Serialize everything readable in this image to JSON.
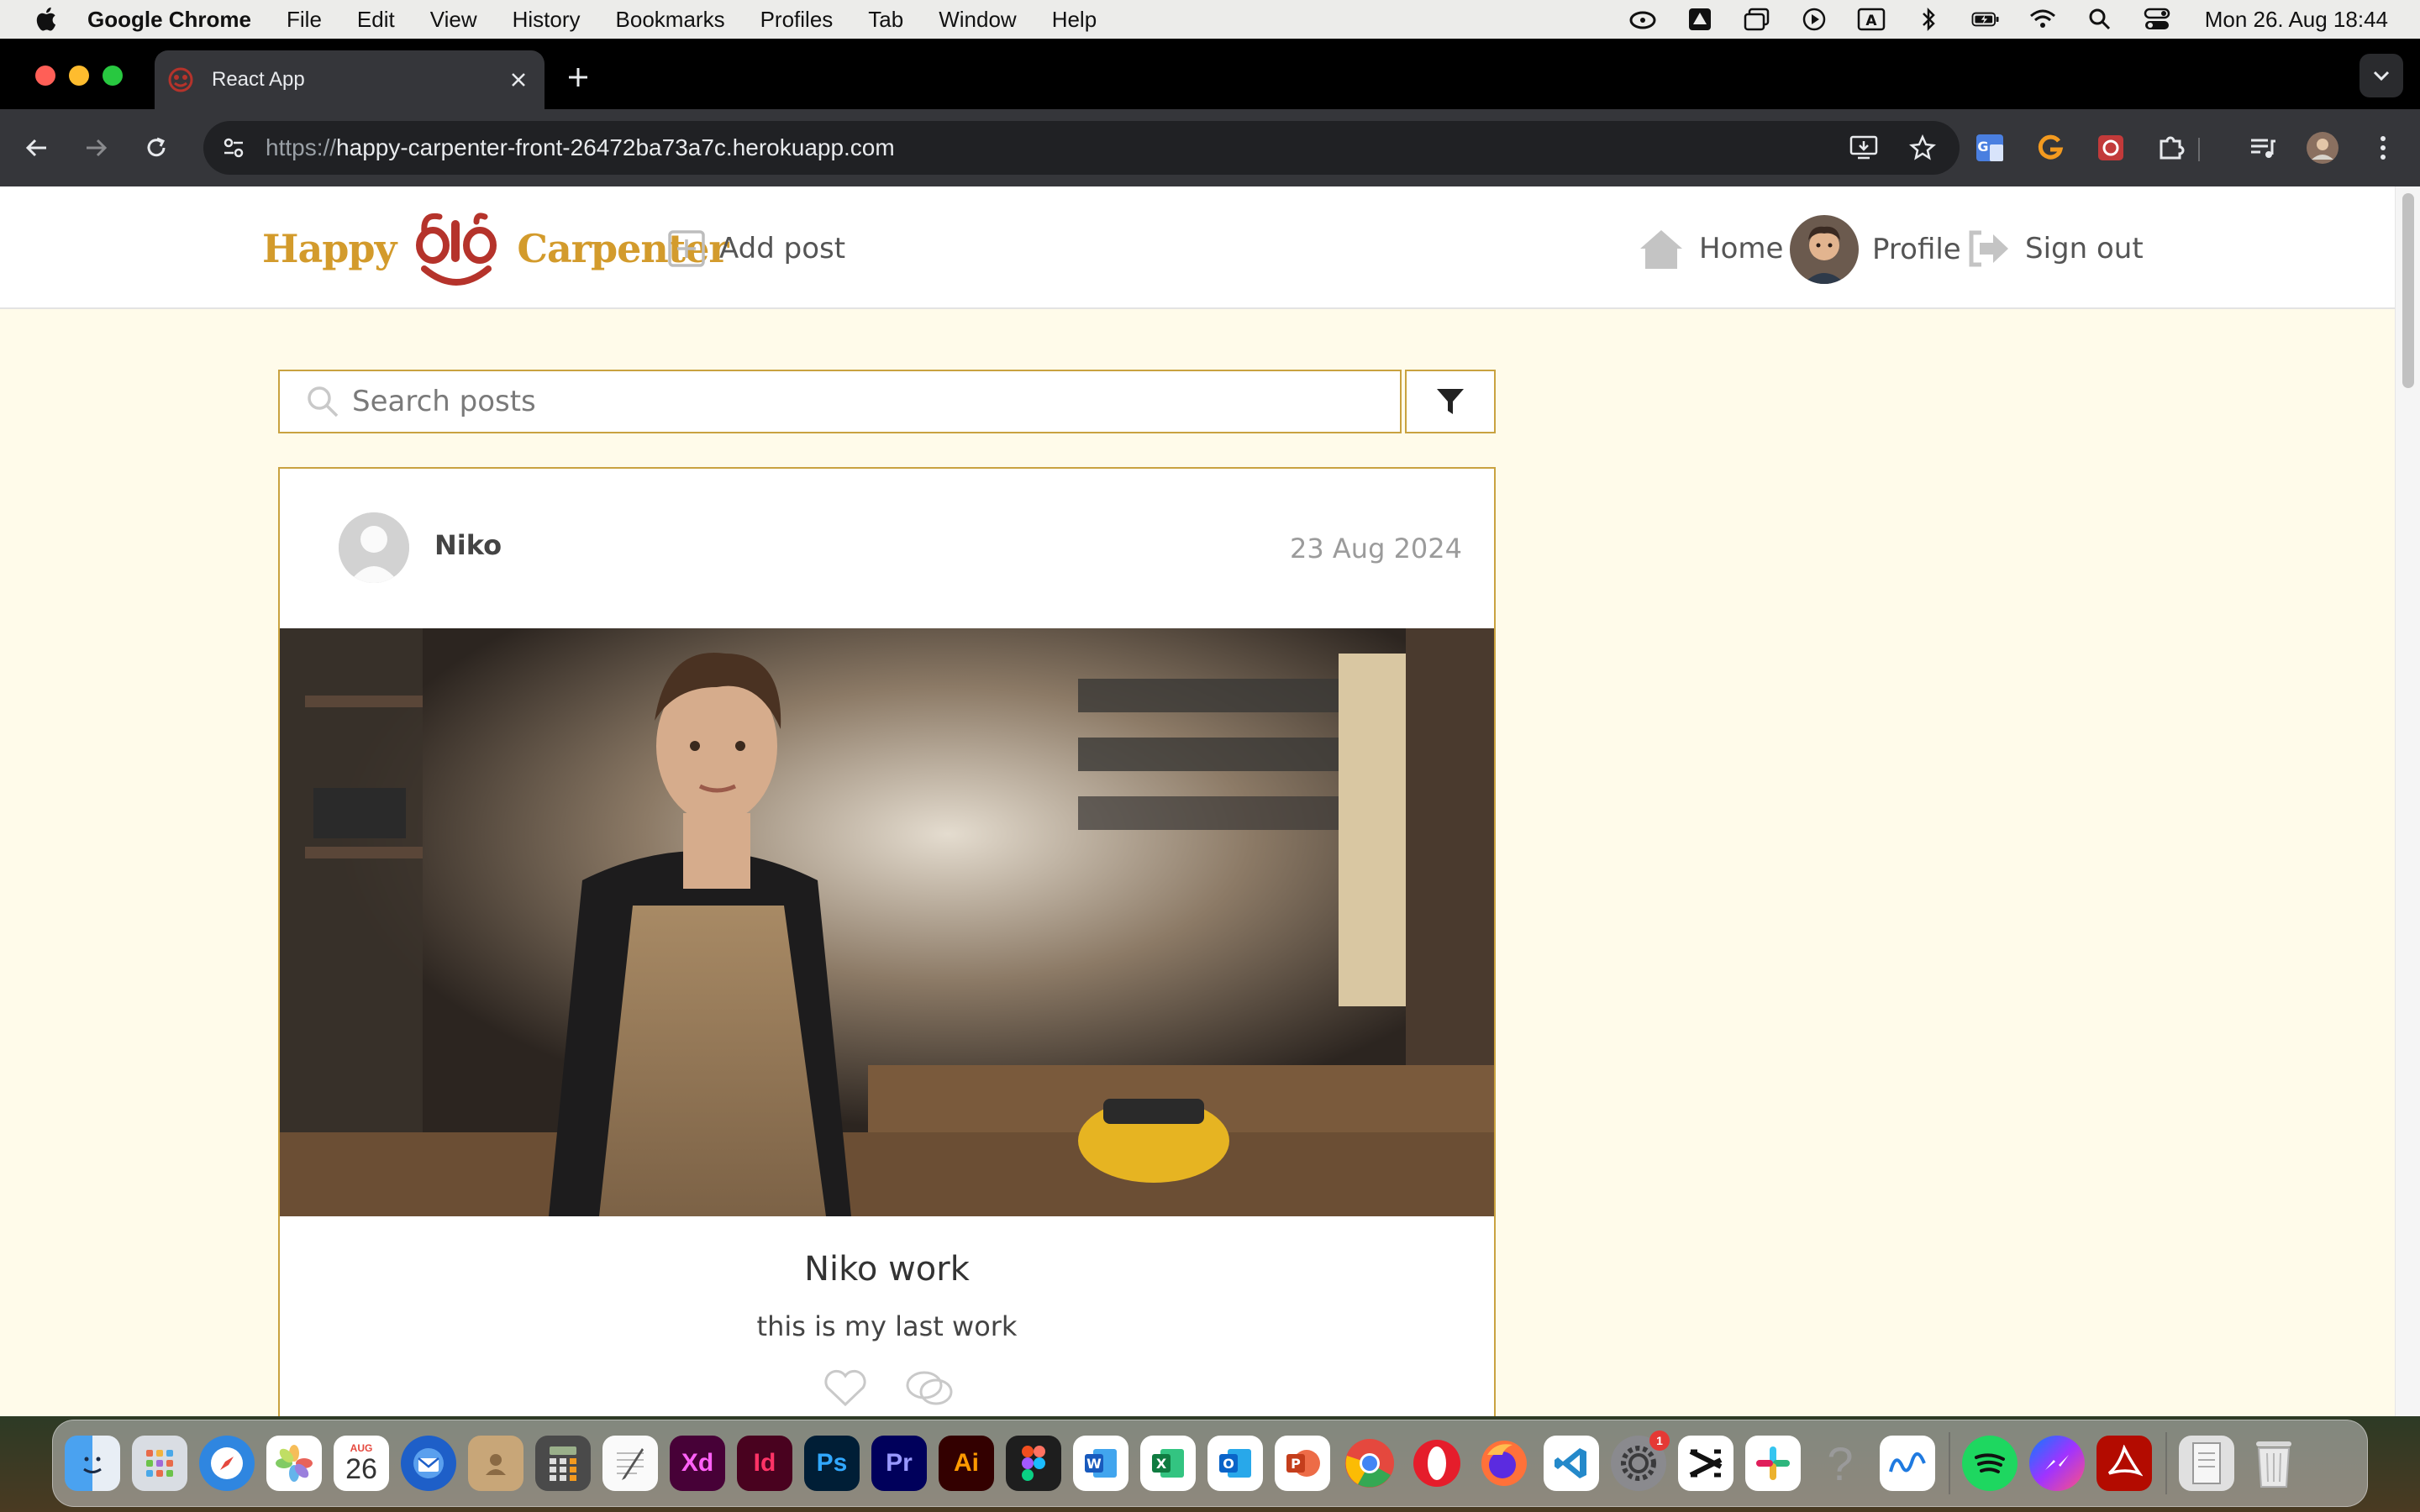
{
  "menubar": {
    "app_name": "Google Chrome",
    "items": [
      "File",
      "Edit",
      "View",
      "History",
      "Bookmarks",
      "Profiles",
      "Tab",
      "Window",
      "Help"
    ],
    "clock": "Mon 26. Aug  18:44",
    "status_icons": [
      "creative-cloud-icon",
      "drive-icon",
      "window-icon",
      "play-icon",
      "input-source-icon",
      "bluetooth-icon",
      "battery-icon",
      "wifi-icon",
      "spotlight-icon",
      "control-center-icon"
    ]
  },
  "browser": {
    "tab_title": "React App",
    "url_scheme": "https://",
    "url_host": "happy-carpenter-front-26472ba73a7c.herokuapp.com"
  },
  "site": {
    "logo_left": "Happy",
    "logo_right": "Carpenter",
    "nav": {
      "add_post": "Add post",
      "home": "Home",
      "profile": "Profile",
      "sign_out": "Sign out"
    },
    "search": {
      "placeholder": "Search posts",
      "value": ""
    },
    "post": {
      "author": "Niko",
      "date": "23 Aug 2024",
      "title": "Niko work",
      "body": "this is my last work"
    }
  },
  "dock": {
    "apps": [
      "Finder",
      "Launchpad",
      "Safari",
      "Photos",
      "Calendar",
      "Thunderbird",
      "Contacts",
      "Calculator",
      "TextEdit",
      "Adobe XD",
      "InDesign",
      "Photoshop",
      "Premiere Pro",
      "Illustrator",
      "Figma",
      "Word",
      "Excel",
      "Outlook",
      "PowerPoint",
      "Chrome",
      "Opera",
      "Firefox",
      "VS Code",
      "System Settings",
      "CapCut",
      "Slack",
      "Help",
      "Freeform",
      "Spotify",
      "Messenger",
      "Acrobat",
      "Documents",
      "Trash"
    ],
    "calendar_month": "AUG",
    "calendar_day": "26",
    "xd": "Xd",
    "id": "Id",
    "ps": "Ps",
    "pr": "Pr",
    "ai": "Ai",
    "settings_badge": "1"
  },
  "colors": {
    "accent": "#c9a240",
    "logo_gold": "#d39b2c",
    "logo_red": "#b5332b",
    "page_bg": "#fffbea"
  }
}
